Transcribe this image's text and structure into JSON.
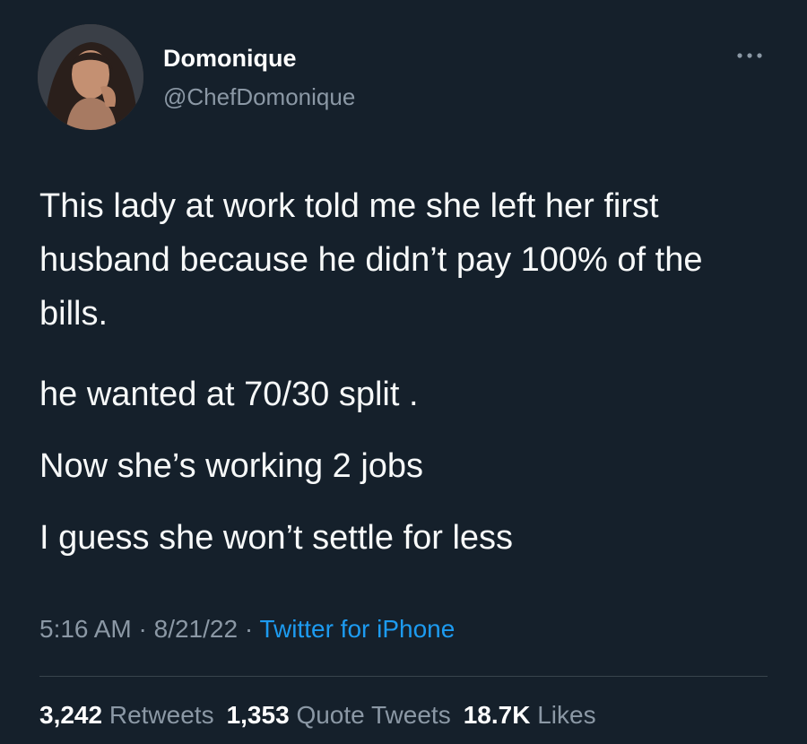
{
  "author": {
    "name": "Domonique",
    "handle": "@ChefDomonique"
  },
  "tweet": {
    "paragraphs": [
      "This lady at work told me she left her first husband because he didn’t pay 100% of the bills.",
      "he wanted at 70/30 split .",
      "Now she’s working 2 jobs",
      "I guess she won’t settle for less"
    ],
    "time": "5:16 AM",
    "date": "8/21/22",
    "separator": " · ",
    "source": "Twitter for iPhone"
  },
  "stats": {
    "retweets_count": "3,242",
    "retweets_label": "Retweets",
    "quotes_count": "1,353",
    "quotes_label": "Quote Tweets",
    "likes_count": "18.7K",
    "likes_label": "Likes"
  },
  "icons": {
    "more": "more-dots-icon"
  },
  "colors": {
    "background": "#15202b",
    "text": "#f7f9f9",
    "secondary": "#8b98a5",
    "link": "#1d9bf0",
    "divider": "#38444d"
  }
}
